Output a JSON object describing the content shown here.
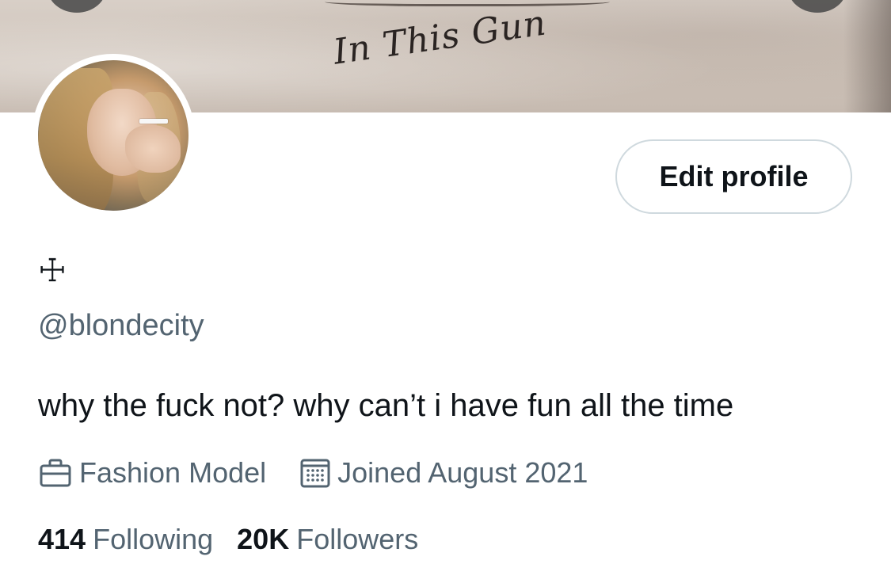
{
  "banner": {
    "tattoo_text": "In This Gun"
  },
  "profile": {
    "display_name": "☩",
    "handle": "@blondecity",
    "bio": "why the fuck not? why can’t i have fun all the time",
    "profession": "Fashion Model",
    "joined": "Joined August 2021"
  },
  "actions": {
    "edit_profile": "Edit profile"
  },
  "stats": {
    "following_count": "414",
    "following_label": "Following",
    "followers_count": "20K",
    "followers_label": "Followers"
  },
  "colors": {
    "text_primary": "#0f1419",
    "text_secondary": "#536471",
    "border": "#cfd9de"
  }
}
